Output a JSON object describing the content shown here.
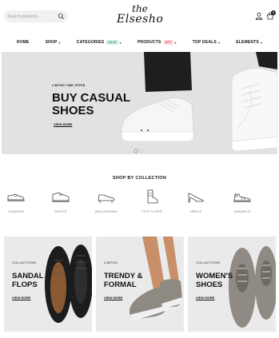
{
  "header": {
    "search_placeholder": "Search products...",
    "logo_line1": "the",
    "logo_line2": "Elsesho",
    "cart_count": "0"
  },
  "nav": {
    "home": "HOME",
    "shop": "SHOP",
    "categories": "CATEGORIES",
    "categories_badge": "SALE",
    "products": "PRODUCTS",
    "products_badge": "HOT",
    "top_deals": "TOP DEALS",
    "elements": "ELEMENTS"
  },
  "hero": {
    "kicker": "LIMITED TIME OFFER",
    "title": "BUY CASUAL SHOES",
    "link": "VIEW MORE",
    "slide_count": 2,
    "active_slide": 1
  },
  "collections": {
    "title": "SHOP BY COLLECTION",
    "items": [
      {
        "label": "LOAFERS",
        "icon": "loafer-icon"
      },
      {
        "label": "BOOTS",
        "icon": "boot-icon"
      },
      {
        "label": "BALLERINAS",
        "icon": "ballerina-icon"
      },
      {
        "label": "FLIP FLOPS",
        "icon": "flip-flop-icon"
      },
      {
        "label": "HEELS",
        "icon": "heel-icon"
      },
      {
        "label": "SANDELS",
        "icon": "sandal-icon"
      }
    ]
  },
  "banners": [
    {
      "kicker": "COLLACTIONS",
      "title": "SANDAL FLOPS",
      "link": "VIEW MORE"
    },
    {
      "kicker": "LIMITED",
      "title": "TRENDY & FORMAL",
      "link": "VIEW MORE"
    },
    {
      "kicker": "COLLACTIONS",
      "title": "WOMEN'S SHOES",
      "link": "VIEW MORE"
    }
  ],
  "colors": {
    "hero_bg": "#e2e2e2",
    "banner_bg": "#eaeaea",
    "sale_badge": "#2b9b66",
    "hot_badge": "#e2495b"
  }
}
